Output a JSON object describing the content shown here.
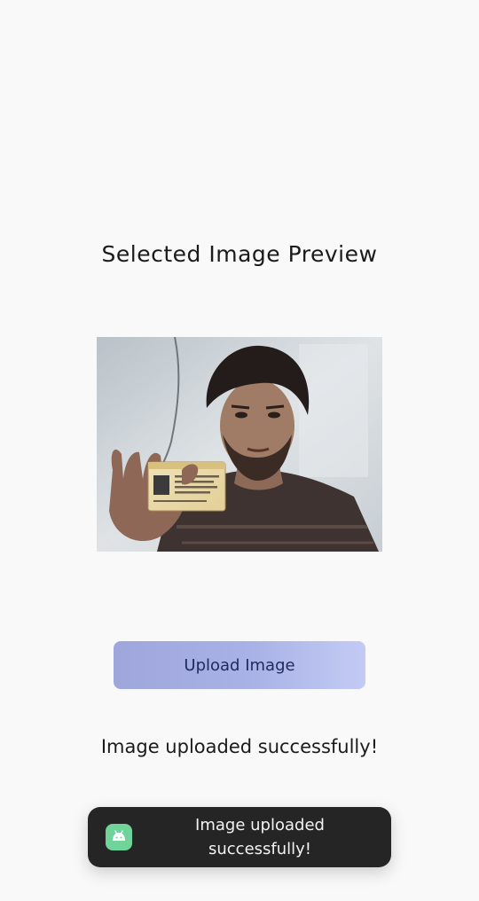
{
  "screen": {
    "title": "Selected Image Preview",
    "upload_button_label": "Upload Image",
    "status_message": "Image uploaded successfully!"
  },
  "toast": {
    "message": "Image uploaded\nsuccessfully!",
    "icon": "android-icon"
  },
  "colors": {
    "background": "#f9f9f9",
    "button_gradient_start": "#9ea6dc",
    "button_gradient_end": "#c3cbf4",
    "button_text": "#1e2a5e",
    "toast_background": "#252525",
    "toast_icon": "#6fd39a"
  }
}
